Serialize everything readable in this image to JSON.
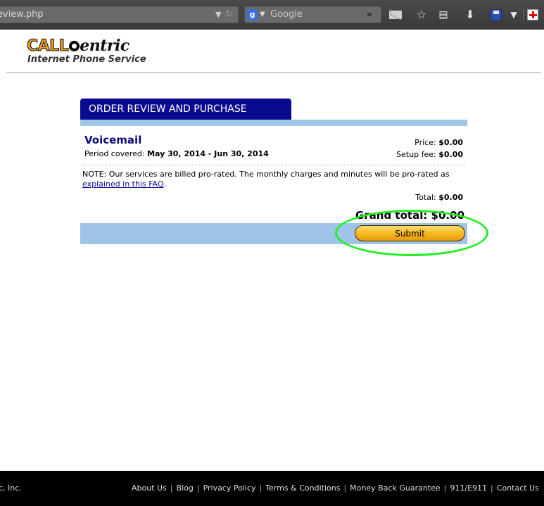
{
  "browser": {
    "url": "eview.php",
    "search_placeholder": "Google"
  },
  "logo": {
    "call": "CALL",
    "entric": "entric",
    "tagline": "Internet Phone Service"
  },
  "order": {
    "tab_title": "ORDER REVIEW AND PURCHASE",
    "item_name": "Voicemail",
    "period_label": "Period covered:",
    "period_value": "May 30, 2014 - Jun 30, 2014",
    "price_label": "Price:",
    "price_value": "$0.00",
    "setup_label": "Setup fee:",
    "setup_value": "$0.00",
    "note_text": "NOTE: Our services are billed pro-rated. The monthly charges and minutes will be pro-rated as",
    "note_link": "explained in this FAQ",
    "note_end": ".",
    "total_label": "Total:",
    "total_value": "$0.00",
    "grand_total": "Grand total: $0.00",
    "submit_label": "Submit"
  },
  "footer": {
    "copyright": "c, Inc.",
    "links": [
      "About Us",
      "Blog",
      "Privacy Policy",
      "Terms & Conditions",
      "Money Back Guarantee",
      "911/E911",
      "Contact Us"
    ]
  },
  "colors": {
    "tab_header": "#0a0a90",
    "bar": "#a0c4e8",
    "submit": "#f6b51c",
    "highlight": "#22ee22"
  }
}
